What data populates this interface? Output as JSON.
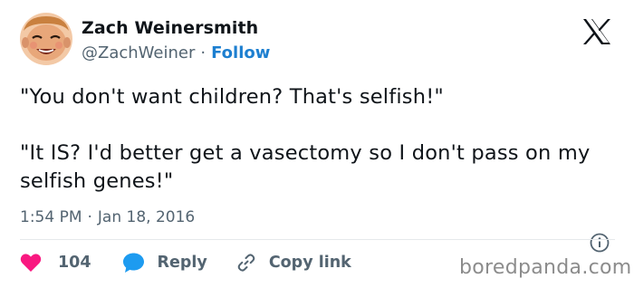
{
  "author": {
    "display_name": "Zach Weinersmith",
    "handle": "@ZachWeiner",
    "separator": "·",
    "follow_label": "Follow",
    "avatar_icon": "cartoon-face-avatar"
  },
  "platform_icon": "x-logo-icon",
  "tweet": {
    "line1": "\"You don't want children? That's selfish!\"",
    "line2": "\"It IS? I'd better get a vasectomy so I don't pass on my selfish genes!\""
  },
  "meta": {
    "time": "1:54 PM",
    "separator": "·",
    "date": "Jan 18, 2016",
    "info_icon": "info-icon"
  },
  "actions": {
    "like_count": "104",
    "reply_label": "Reply",
    "copy_label": "Copy link"
  },
  "watermark": "boredpanda.com",
  "colors": {
    "like": "#f91880",
    "reply": "#1d9bf0",
    "follow": "#1d7fd0",
    "secondary_text": "#536471"
  }
}
